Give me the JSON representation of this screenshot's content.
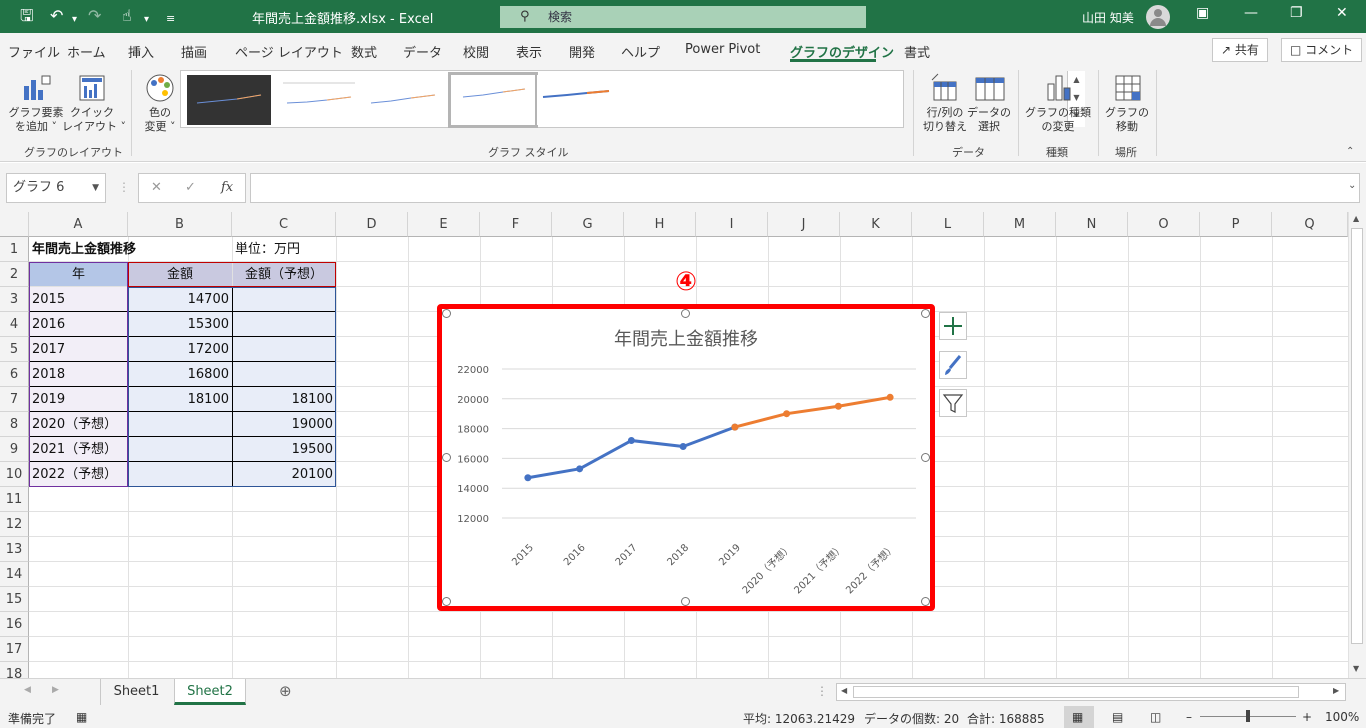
{
  "titlebar": {
    "filename": "年間売上金額推移.xlsx",
    "separator": "-",
    "app": "Excel",
    "search_placeholder": "検索",
    "user": "山田 知美"
  },
  "menu": {
    "tabs": [
      "ファイル",
      "ホーム",
      "挿入",
      "描画",
      "ページ レイアウト",
      "数式",
      "データ",
      "校閲",
      "表示",
      "開発",
      "ヘルプ",
      "Power Pivot",
      "グラフのデザイン",
      "書式"
    ],
    "active_tab": "グラフのデザイン",
    "share": "共有",
    "comment": "コメント"
  },
  "ribbon": {
    "add_element_1": "グラフ要素",
    "add_element_2": "を追加",
    "quick_layout_1": "クイック",
    "quick_layout_2": "レイアウト",
    "change_color_1": "色の",
    "change_color_2": "変更",
    "group_layout": "グラフのレイアウト",
    "group_style": "グラフ スタイル",
    "switch_row_col_1": "行/列の",
    "switch_row_col_2": "切り替え",
    "select_data_1": "データの",
    "select_data_2": "選択",
    "group_data": "データ",
    "change_type_1": "グラフの種類",
    "change_type_2": "の変更",
    "group_type": "種類",
    "move_chart_1": "グラフの",
    "move_chart_2": "移動",
    "group_location": "場所"
  },
  "formula": {
    "name_box": "グラフ 6",
    "fx": "fx",
    "value": ""
  },
  "columns": [
    "A",
    "B",
    "C",
    "D",
    "E",
    "F",
    "G",
    "H",
    "I",
    "J",
    "K",
    "L",
    "M",
    "N",
    "O",
    "P",
    "Q"
  ],
  "rows": [
    "1",
    "2",
    "3",
    "4",
    "5",
    "6",
    "7",
    "8",
    "9",
    "10",
    "11",
    "12",
    "13",
    "14",
    "15",
    "16",
    "17",
    "18"
  ],
  "sheet": {
    "a1": "年間売上金額推移",
    "c1": "単位：万円",
    "headers": [
      "年",
      "金額",
      "金額（予想）"
    ],
    "data": [
      [
        "2015",
        "14700",
        ""
      ],
      [
        "2016",
        "15300",
        ""
      ],
      [
        "2017",
        "17200",
        ""
      ],
      [
        "2018",
        "16800",
        ""
      ],
      [
        "2019",
        "18100",
        "18100"
      ],
      [
        "2020（予想）",
        "",
        "19000"
      ],
      [
        "2021（予想）",
        "",
        "19500"
      ],
      [
        "2022（予想）",
        "",
        "20100"
      ]
    ]
  },
  "annotation": "④",
  "chart_data": {
    "type": "line",
    "title": "年間売上金額推移",
    "categories": [
      "2015",
      "2016",
      "2017",
      "2018",
      "2019",
      "2020（予想）",
      "2021（予想）",
      "2022（予想）"
    ],
    "series": [
      {
        "values": [
          14700,
          15300,
          17200,
          16800,
          18100,
          null,
          null,
          null
        ],
        "color": "#4472c4"
      },
      {
        "values": [
          null,
          null,
          null,
          null,
          18100,
          19000,
          19500,
          20100
        ],
        "color": "#ed7d31"
      }
    ],
    "ylim": [
      12000,
      22000
    ],
    "yticks": [
      "12000",
      "14000",
      "16000",
      "18000",
      "20000",
      "22000"
    ],
    "grid": true
  },
  "sheet_tabs": [
    "Sheet1",
    "Sheet2"
  ],
  "active_sheet": "Sheet2",
  "status": {
    "ready": "準備完了",
    "average": "平均: 12063.21429",
    "count": "データの個数: 20",
    "sum": "合計: 168885",
    "zoom": "100%"
  }
}
